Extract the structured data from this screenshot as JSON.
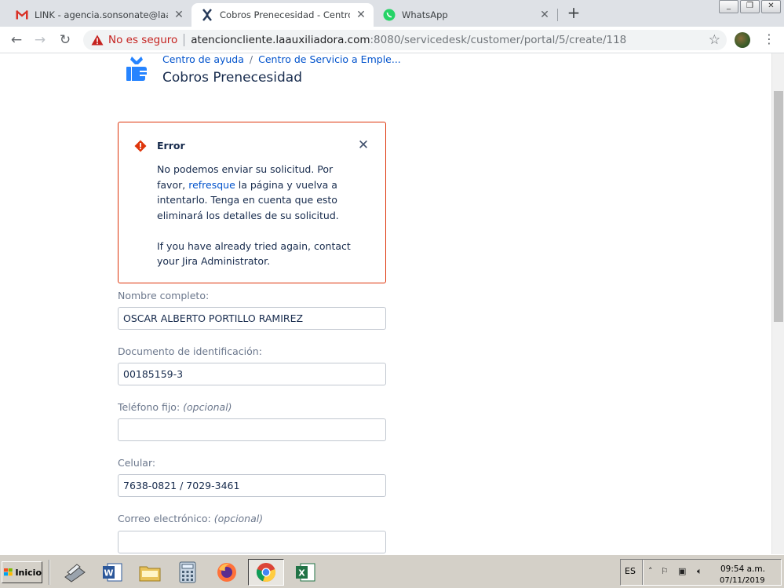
{
  "browser": {
    "tabs": [
      {
        "icon": "gmail-icon",
        "label": "LINK - agencia.sonsonate@laauxiliadora",
        "active": false
      },
      {
        "icon": "jira-service-desk-icon",
        "label": "Cobros Prenecesidad - Centro de Se",
        "active": true
      },
      {
        "icon": "whatsapp-icon",
        "label": "WhatsApp",
        "active": false
      }
    ],
    "new_tab": "+",
    "window_buttons": [
      "_",
      "❐",
      "✕"
    ],
    "security_label": "No es seguro",
    "url_host": "atencioncliente.laauxiliadora.com",
    "url_rest": ":8080/servicedesk/customer/portal/5/create/118"
  },
  "page": {
    "breadcrumb": [
      "Centro de ayuda",
      "Centro de Servicio a Emple..."
    ],
    "breadcrumb_separator": "/",
    "title": "Cobros Prenecesidad",
    "error": {
      "title": "Error",
      "body_part1": "No podemos enviar su solicitud. Por favor, ",
      "body_link": "refresque",
      "body_part2": " la página y vuelva a intentarlo. Tenga en cuenta que esto eliminará los detalles de su solicitud.",
      "body_second": "If you have already tried again, contact your Jira Administrator."
    },
    "fields": [
      {
        "label": "Nombre completo:",
        "optional": "",
        "value": "OSCAR ALBERTO PORTILLO RAMIREZ"
      },
      {
        "label": "Documento de identificación:",
        "optional": "",
        "value": "00185159-3"
      },
      {
        "label": "Teléfono fijo:",
        "optional": "(opcional)",
        "value": ""
      },
      {
        "label": "Celular:",
        "optional": "",
        "value": "7638-0821 / 7029-3461"
      },
      {
        "label": "Correo electrónico:",
        "optional": "(opcional)",
        "value": ""
      }
    ]
  },
  "taskbar": {
    "start_label": "Inicio",
    "apps": [
      "scanner-icon",
      "word-icon",
      "explorer-folder-icon",
      "calculator-icon",
      "firefox-icon",
      "chrome-icon",
      "excel-icon"
    ],
    "language": "ES",
    "time": "09:54 a.m.",
    "date": "07/11/2019"
  },
  "colors": {
    "link": "#0052cc",
    "error_border": "#de350b",
    "text": "#172b4d",
    "label": "#6b778c",
    "insecure": "#c5221f"
  }
}
